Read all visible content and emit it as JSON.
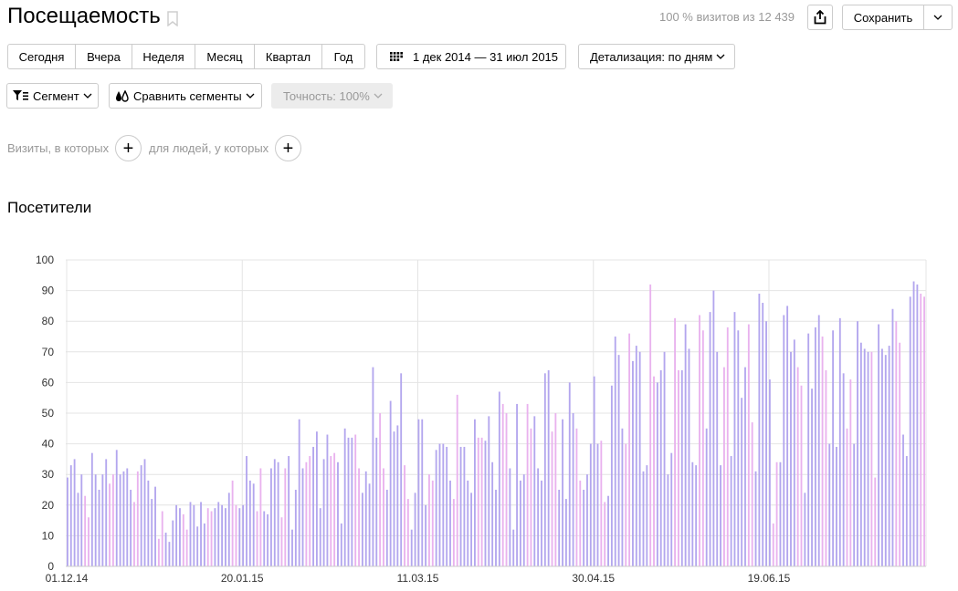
{
  "header": {
    "title": "Посещаемость",
    "visits_info": "100 % визитов из 12 439",
    "save_label": "Сохранить"
  },
  "periods": [
    "Сегодня",
    "Вчера",
    "Неделя",
    "Месяц",
    "Квартал",
    "Год"
  ],
  "date_range": "1 дек 2014 — 31 июл 2015",
  "detail": "Детализация: по дням",
  "segment": "Сегмент",
  "compare": "Сравнить сегменты",
  "accuracy": "Точность: 100%",
  "filters": {
    "visits_label": "Визиты, в которых",
    "people_label": "для людей, у которых"
  },
  "section_title": "Посетители",
  "colors": {
    "weekday_bar": "#b3a6ee",
    "weekend_bar": "#e9b2ee",
    "grid": "#e4e4e4"
  },
  "chart_data": {
    "type": "bar",
    "title": "",
    "xlabel": "",
    "ylabel": "",
    "ylim": [
      0,
      100
    ],
    "y_ticks": [
      0,
      10,
      20,
      30,
      40,
      50,
      60,
      70,
      80,
      90,
      100
    ],
    "x_tick_labels": [
      "01.12.14",
      "20.01.15",
      "11.03.15",
      "30.04.15",
      "19.06.15"
    ],
    "x_tick_indices": [
      0,
      50,
      100,
      150,
      200
    ],
    "series": [
      {
        "start_date": "01.12.14",
        "values": [
          29,
          33,
          35,
          24,
          30,
          23,
          16,
          37,
          30,
          25,
          30,
          35,
          27,
          30,
          38,
          30,
          31,
          32,
          25,
          21,
          31,
          33,
          35,
          28,
          22,
          26,
          9,
          18,
          11,
          8,
          15,
          20,
          19,
          17,
          12,
          21,
          20,
          13,
          21,
          14,
          19,
          18,
          19,
          21,
          20,
          19,
          24,
          28,
          20,
          19,
          20,
          36,
          28,
          27,
          18,
          32,
          18,
          17,
          32,
          35,
          34,
          16,
          32,
          36,
          12,
          25,
          48,
          32,
          34,
          36,
          39,
          44,
          19,
          35,
          43,
          36,
          37,
          34,
          14,
          45,
          42,
          42,
          43,
          32,
          24,
          31,
          27,
          65,
          42,
          50,
          32,
          25,
          54,
          44,
          46,
          63,
          33,
          22,
          12,
          24,
          48,
          48,
          20,
          30,
          28,
          38,
          40,
          40,
          39,
          28,
          22,
          56,
          39,
          39,
          28,
          24,
          48,
          42,
          42,
          41,
          49,
          34,
          25,
          57,
          53,
          50,
          32,
          12,
          53,
          28,
          30,
          53,
          45,
          49,
          32,
          28,
          63,
          64,
          44,
          50,
          25,
          48,
          22,
          60,
          50,
          45,
          28,
          25,
          30,
          40,
          62,
          40,
          41,
          21,
          23,
          59,
          75,
          69,
          45,
          40,
          76,
          67,
          72,
          70,
          31,
          33,
          92,
          62,
          60,
          64,
          70,
          30,
          37,
          81,
          64,
          64,
          79,
          71,
          34,
          33,
          82,
          77,
          45,
          83,
          90,
          70,
          33,
          65,
          78,
          36,
          83,
          77,
          55,
          65,
          79,
          47,
          31,
          89,
          86,
          80,
          61,
          14,
          34,
          34,
          82,
          85,
          70,
          74,
          65,
          59,
          24,
          76,
          58,
          78,
          82,
          75,
          64,
          40,
          77,
          39,
          81,
          63,
          45,
          61,
          40,
          80,
          73,
          71,
          70,
          70,
          29,
          79,
          71,
          69,
          72,
          84,
          80,
          73,
          43,
          36,
          88,
          93,
          92,
          89,
          88
        ]
      }
    ]
  }
}
